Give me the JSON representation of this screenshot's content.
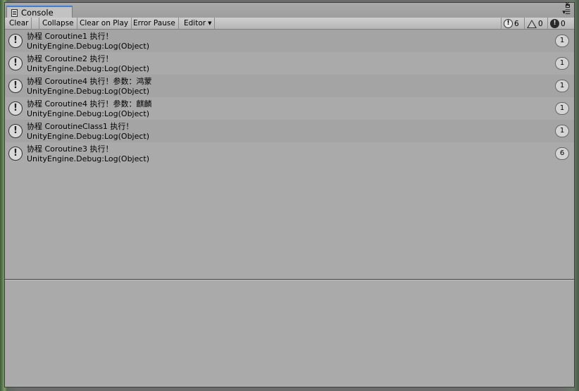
{
  "window": {
    "tab_title": "Console",
    "window_buttons": [
      "maximize-icon",
      "close-icon",
      "menu-icon"
    ]
  },
  "toolbar": {
    "clear": "Clear",
    "collapse": "Collapse",
    "clear_on_play": "Clear on Play",
    "error_pause": "Error Pause",
    "editor": "Editor",
    "counters": {
      "info": "6",
      "warning": "0",
      "error": "0"
    }
  },
  "logs": [
    {
      "message": "协程 Coroutine1 执行！",
      "stack": "UnityEngine.Debug:Log(Object)",
      "count": "1"
    },
    {
      "message": "协程 Coroutine2 执行！",
      "stack": "UnityEngine.Debug:Log(Object)",
      "count": "1"
    },
    {
      "message": "协程 Coroutine4 执行！参数：鸿蒙",
      "stack": "UnityEngine.Debug:Log(Object)",
      "count": "1"
    },
    {
      "message": "协程 Coroutine4 执行！参数：麒麟",
      "stack": "UnityEngine.Debug:Log(Object)",
      "count": "1"
    },
    {
      "message": "协程 CoroutineClass1 执行！",
      "stack": "UnityEngine.Debug:Log(Object)",
      "count": "1"
    },
    {
      "message": "协程 Coroutine3 执行！",
      "stack": "UnityEngine.Debug:Log(Object)",
      "count": "6"
    }
  ],
  "icons": {
    "info": "info-exclamation-icon",
    "warning": "warning-triangle-icon",
    "error": "error-circle-icon"
  }
}
